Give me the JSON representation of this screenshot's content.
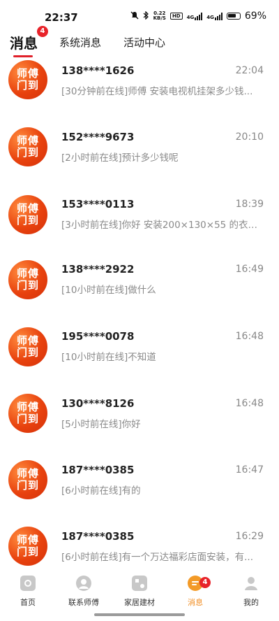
{
  "status": {
    "time": "22:37",
    "net_speed_top": "0.22",
    "net_speed_bottom": "KB/S",
    "hd": "HD",
    "sig1": "4G",
    "sig2": "4G",
    "battery": "69%"
  },
  "tabs": {
    "messages": "消息",
    "messages_badge": "4",
    "system": "系统消息",
    "activity": "活动中心"
  },
  "avatar_text": {
    "line1": "师傅",
    "line2": "门到"
  },
  "messages": [
    {
      "phone": "138****1626",
      "time": "22:04",
      "text": "[30分钟前在线]师傅 安装电视机挂架多少钱..."
    },
    {
      "phone": "152****9673",
      "time": "20:10",
      "text": "[2小时前在线]预计多少钱呢"
    },
    {
      "phone": "153****0113",
      "time": "18:39",
      "text": "[3小时前在线]你好 安装200×130×55 的衣柜 ..."
    },
    {
      "phone": "138****2922",
      "time": "16:49",
      "text": "[10小时前在线]做什么"
    },
    {
      "phone": "195****0078",
      "time": "16:48",
      "text": "[10小时前在线]不知道"
    },
    {
      "phone": "130****8126",
      "time": "16:48",
      "text": "[5小时前在线]你好"
    },
    {
      "phone": "187****0385",
      "time": "16:47",
      "text": "[6小时前在线]有的"
    },
    {
      "phone": "187****0385",
      "time": "16:29",
      "text": "[6小时前在线]有一个万达福彩店面安装，有..."
    }
  ],
  "nav": {
    "home": "首页",
    "contact": "联系师傅",
    "materials": "家居建材",
    "messages": "消息",
    "messages_badge": "4",
    "mine": "我的"
  },
  "colors": {
    "accent": "#e0202a",
    "avatar": "#e8420e",
    "nav_active": "#f08a1c"
  }
}
